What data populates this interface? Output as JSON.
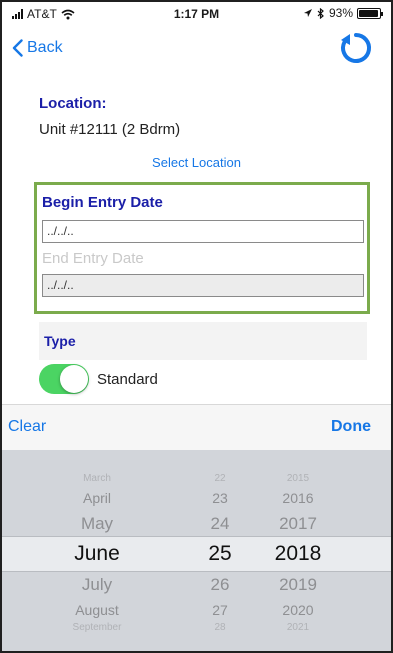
{
  "status_bar": {
    "carrier": "AT&T",
    "time": "1:17 PM",
    "battery": "93%",
    "battery_level": 0.93,
    "icons": [
      "signal-icon",
      "wifi-icon",
      "location-arrow-icon",
      "bluetooth-icon",
      "battery-icon"
    ]
  },
  "nav": {
    "back_label": "Back",
    "refresh_icon": "refresh-icon"
  },
  "location": {
    "label": "Location:",
    "value": "Unit #12111 (2 Bdrm)",
    "select_label": "Select Location"
  },
  "dates": {
    "begin_label": "Begin Entry Date",
    "begin_value": "../../..",
    "end_label": "End Entry Date",
    "end_value": "../../.."
  },
  "type": {
    "label": "Type",
    "toggle_label": "Standard",
    "toggle_on": true
  },
  "toolbar": {
    "clear_label": "Clear",
    "done_label": "Done"
  },
  "picker": {
    "months": [
      "March",
      "April",
      "May",
      "June",
      "July",
      "August",
      "September"
    ],
    "days": [
      "22",
      "23",
      "24",
      "25",
      "26",
      "27",
      "28"
    ],
    "years": [
      "2015",
      "2016",
      "2017",
      "2018",
      "2019",
      "2020",
      "2021"
    ],
    "selected_month": "June",
    "selected_day": "25",
    "selected_year": "2018"
  },
  "colors": {
    "accent": "#1677e6",
    "label_blue": "#1b1fa8",
    "highlight_border": "#7bab4c",
    "toggle_on": "#4bd463"
  }
}
